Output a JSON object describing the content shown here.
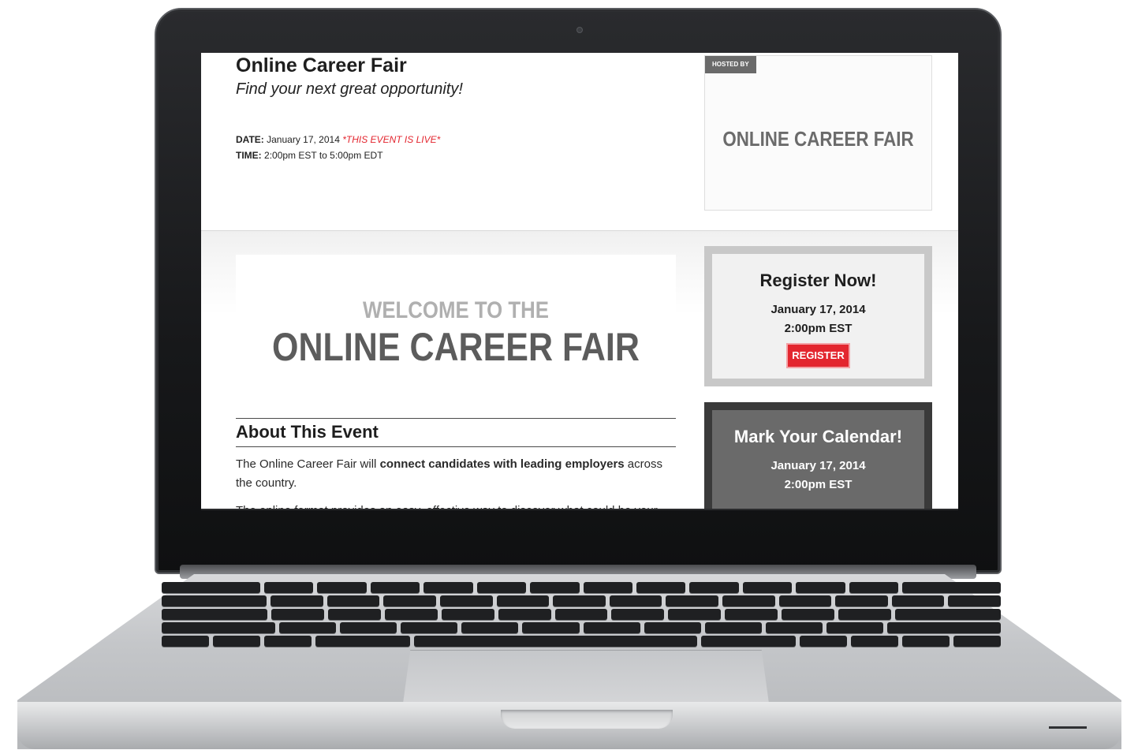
{
  "event": {
    "title": "Online Career Fair",
    "tagline": "Find your next great opportunity!",
    "date_label": "DATE:",
    "date_value": "January 17, 2014",
    "live_badge": "*THIS EVENT IS LIVE*",
    "time_label": "TIME:",
    "time_value": "2:00pm EST to 5:00pm EDT"
  },
  "host": {
    "tag": "HOSTED BY",
    "logo_text": "ONLINE CAREER FAIR"
  },
  "welcome": {
    "line1": "WELCOME TO THE",
    "line2": "ONLINE CAREER FAIR"
  },
  "about": {
    "heading": "About This Event",
    "para1_start": "The Online Career Fair will ",
    "para1_bold": "connect candidates with leading employers",
    "para1_end": " across the country.",
    "para2": "The online format provides an easy, effective way to discover what could be your"
  },
  "register_card": {
    "title": "Register Now!",
    "date": "January 17, 2014",
    "time": "2:00pm EST",
    "button_label": "REGISTER"
  },
  "calendar_card": {
    "title": "Mark Your Calendar!",
    "date": "January 17, 2014",
    "time": "2:00pm EST"
  },
  "colors": {
    "accent_red": "#e3262f",
    "dark_text": "#1e1e1e",
    "logo_gray": "#6b6b6b"
  }
}
